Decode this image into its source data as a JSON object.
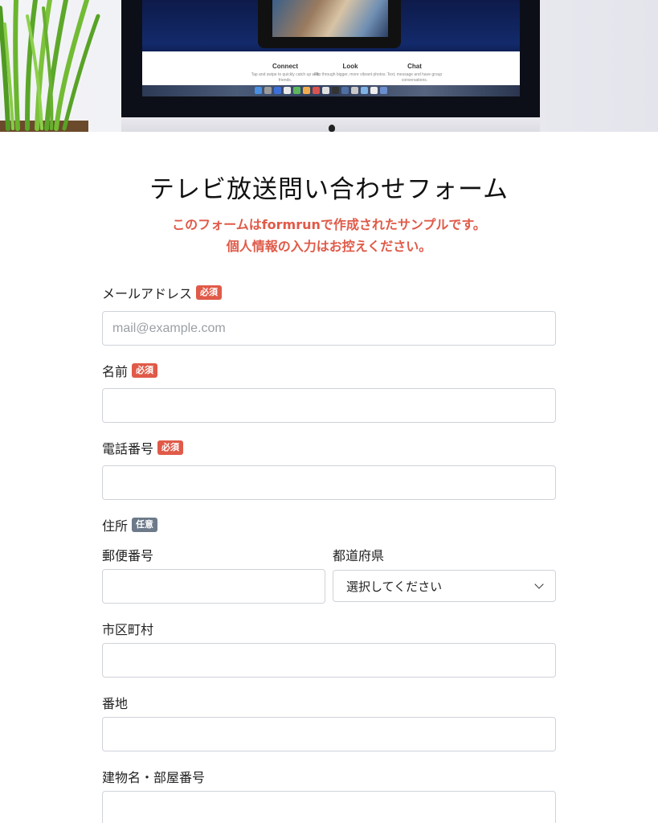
{
  "hero": {
    "features": [
      {
        "title": "Connect",
        "sub": "Tap and swipe to quickly catch up with friends."
      },
      {
        "title": "Look",
        "sub": "Flip through bigger, more vibrant photos."
      },
      {
        "title": "Chat",
        "sub": "Text, message and have group conversations."
      }
    ]
  },
  "form": {
    "title": "テレビ放送問い合わせフォーム",
    "notice_line1": "このフォームはformrunで作成されたサンプルです。",
    "notice_line2": "個人情報の入力はお控えください。",
    "badges": {
      "required": "必須",
      "optional": "任意"
    },
    "email": {
      "label": "メールアドレス",
      "placeholder": "mail@example.com",
      "value": ""
    },
    "name": {
      "label": "名前",
      "value": ""
    },
    "phone": {
      "label": "電話番号",
      "value": ""
    },
    "address": {
      "label": "住所",
      "postal": {
        "label": "郵便番号",
        "value": ""
      },
      "prefecture": {
        "label": "都道府県",
        "selected": "選択してください"
      },
      "city": {
        "label": "市区町村",
        "value": ""
      },
      "street": {
        "label": "番地",
        "value": ""
      },
      "building": {
        "label": "建物名・部屋番号",
        "value": ""
      }
    }
  },
  "colors": {
    "required_badge": "#e05a48",
    "optional_badge": "#6c7a89",
    "notice_text": "#e05a48"
  }
}
